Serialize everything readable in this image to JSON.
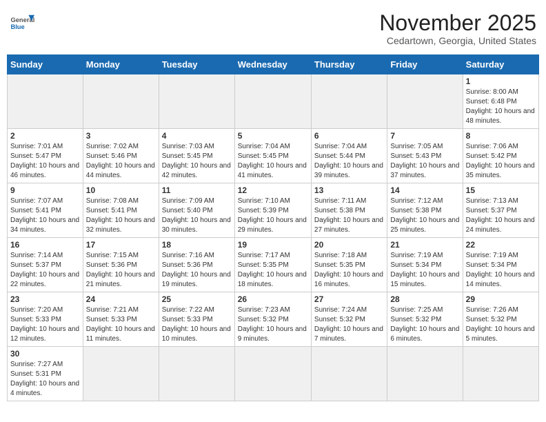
{
  "header": {
    "logo_general": "General",
    "logo_blue": "Blue",
    "month": "November 2025",
    "location": "Cedartown, Georgia, United States"
  },
  "days_of_week": [
    "Sunday",
    "Monday",
    "Tuesday",
    "Wednesday",
    "Thursday",
    "Friday",
    "Saturday"
  ],
  "weeks": [
    [
      {
        "day": null,
        "empty": true
      },
      {
        "day": null,
        "empty": true
      },
      {
        "day": null,
        "empty": true
      },
      {
        "day": null,
        "empty": true
      },
      {
        "day": null,
        "empty": true
      },
      {
        "day": null,
        "empty": true
      },
      {
        "day": 1,
        "sunrise": "8:00 AM",
        "sunset": "6:48 PM",
        "daylight": "10 hours and 48 minutes."
      }
    ],
    [
      {
        "day": 2,
        "sunrise": "7:01 AM",
        "sunset": "5:47 PM",
        "daylight": "10 hours and 46 minutes."
      },
      {
        "day": 3,
        "sunrise": "7:02 AM",
        "sunset": "5:46 PM",
        "daylight": "10 hours and 44 minutes."
      },
      {
        "day": 4,
        "sunrise": "7:03 AM",
        "sunset": "5:45 PM",
        "daylight": "10 hours and 42 minutes."
      },
      {
        "day": 5,
        "sunrise": "7:04 AM",
        "sunset": "5:45 PM",
        "daylight": "10 hours and 41 minutes."
      },
      {
        "day": 6,
        "sunrise": "7:04 AM",
        "sunset": "5:44 PM",
        "daylight": "10 hours and 39 minutes."
      },
      {
        "day": 7,
        "sunrise": "7:05 AM",
        "sunset": "5:43 PM",
        "daylight": "10 hours and 37 minutes."
      },
      {
        "day": 8,
        "sunrise": "7:06 AM",
        "sunset": "5:42 PM",
        "daylight": "10 hours and 35 minutes."
      }
    ],
    [
      {
        "day": 9,
        "sunrise": "7:07 AM",
        "sunset": "5:41 PM",
        "daylight": "10 hours and 34 minutes."
      },
      {
        "day": 10,
        "sunrise": "7:08 AM",
        "sunset": "5:41 PM",
        "daylight": "10 hours and 32 minutes."
      },
      {
        "day": 11,
        "sunrise": "7:09 AM",
        "sunset": "5:40 PM",
        "daylight": "10 hours and 30 minutes."
      },
      {
        "day": 12,
        "sunrise": "7:10 AM",
        "sunset": "5:39 PM",
        "daylight": "10 hours and 29 minutes."
      },
      {
        "day": 13,
        "sunrise": "7:11 AM",
        "sunset": "5:38 PM",
        "daylight": "10 hours and 27 minutes."
      },
      {
        "day": 14,
        "sunrise": "7:12 AM",
        "sunset": "5:38 PM",
        "daylight": "10 hours and 25 minutes."
      },
      {
        "day": 15,
        "sunrise": "7:13 AM",
        "sunset": "5:37 PM",
        "daylight": "10 hours and 24 minutes."
      }
    ],
    [
      {
        "day": 16,
        "sunrise": "7:14 AM",
        "sunset": "5:37 PM",
        "daylight": "10 hours and 22 minutes."
      },
      {
        "day": 17,
        "sunrise": "7:15 AM",
        "sunset": "5:36 PM",
        "daylight": "10 hours and 21 minutes."
      },
      {
        "day": 18,
        "sunrise": "7:16 AM",
        "sunset": "5:36 PM",
        "daylight": "10 hours and 19 minutes."
      },
      {
        "day": 19,
        "sunrise": "7:17 AM",
        "sunset": "5:35 PM",
        "daylight": "10 hours and 18 minutes."
      },
      {
        "day": 20,
        "sunrise": "7:18 AM",
        "sunset": "5:35 PM",
        "daylight": "10 hours and 16 minutes."
      },
      {
        "day": 21,
        "sunrise": "7:19 AM",
        "sunset": "5:34 PM",
        "daylight": "10 hours and 15 minutes."
      },
      {
        "day": 22,
        "sunrise": "7:19 AM",
        "sunset": "5:34 PM",
        "daylight": "10 hours and 14 minutes."
      }
    ],
    [
      {
        "day": 23,
        "sunrise": "7:20 AM",
        "sunset": "5:33 PM",
        "daylight": "10 hours and 12 minutes."
      },
      {
        "day": 24,
        "sunrise": "7:21 AM",
        "sunset": "5:33 PM",
        "daylight": "10 hours and 11 minutes."
      },
      {
        "day": 25,
        "sunrise": "7:22 AM",
        "sunset": "5:33 PM",
        "daylight": "10 hours and 10 minutes."
      },
      {
        "day": 26,
        "sunrise": "7:23 AM",
        "sunset": "5:32 PM",
        "daylight": "10 hours and 9 minutes."
      },
      {
        "day": 27,
        "sunrise": "7:24 AM",
        "sunset": "5:32 PM",
        "daylight": "10 hours and 7 minutes."
      },
      {
        "day": 28,
        "sunrise": "7:25 AM",
        "sunset": "5:32 PM",
        "daylight": "10 hours and 6 minutes."
      },
      {
        "day": 29,
        "sunrise": "7:26 AM",
        "sunset": "5:32 PM",
        "daylight": "10 hours and 5 minutes."
      }
    ],
    [
      {
        "day": 30,
        "sunrise": "7:27 AM",
        "sunset": "5:31 PM",
        "daylight": "10 hours and 4 minutes."
      },
      {
        "day": null,
        "empty": true
      },
      {
        "day": null,
        "empty": true
      },
      {
        "day": null,
        "empty": true
      },
      {
        "day": null,
        "empty": true
      },
      {
        "day": null,
        "empty": true
      },
      {
        "day": null,
        "empty": true
      }
    ]
  ],
  "labels": {
    "sunrise": "Sunrise:",
    "sunset": "Sunset:",
    "daylight": "Daylight:"
  }
}
